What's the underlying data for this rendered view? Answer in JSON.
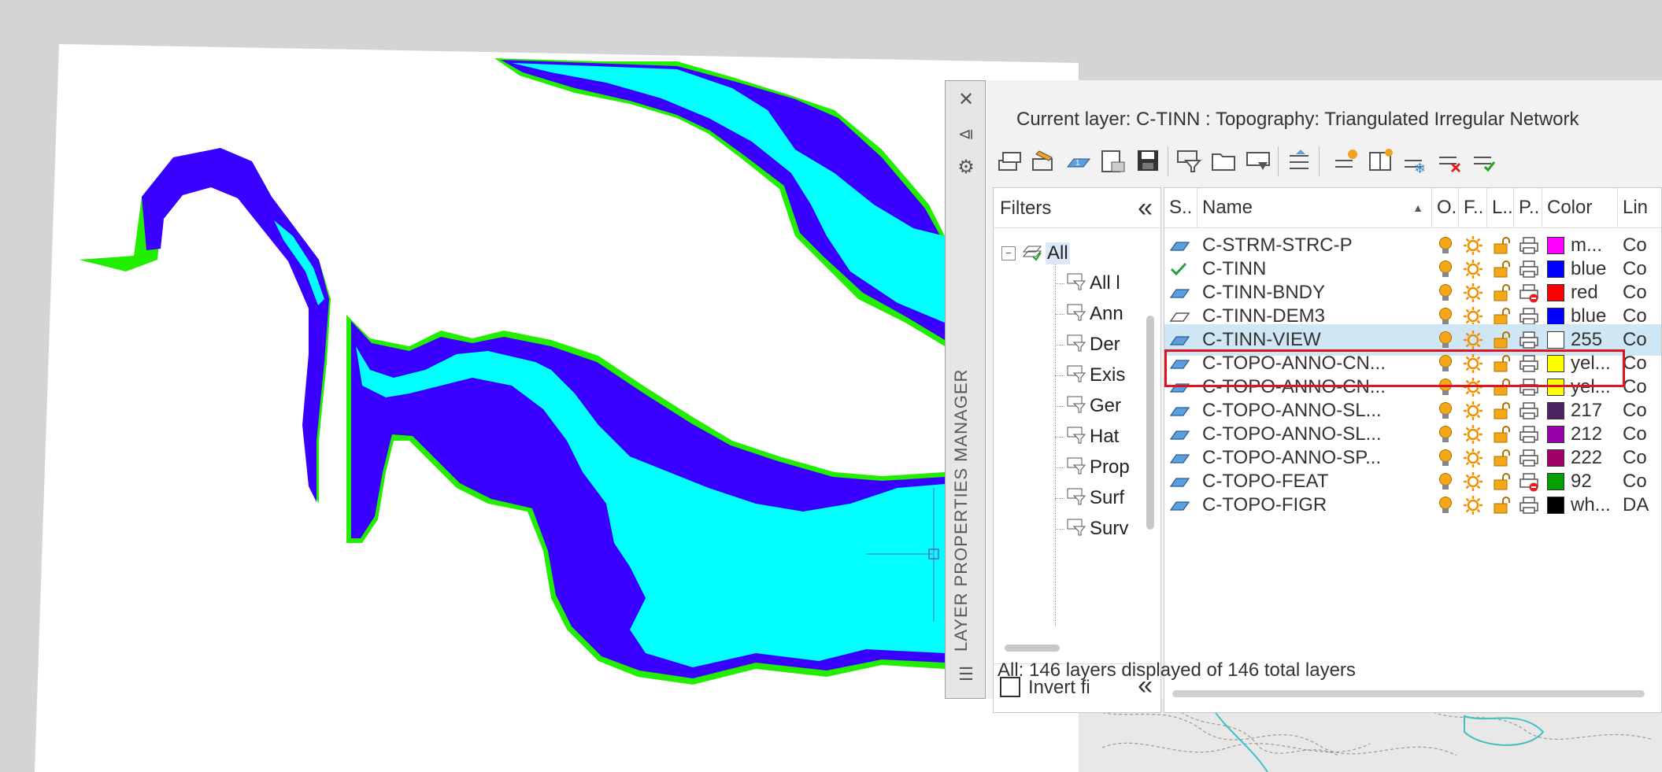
{
  "colors": {
    "canvas_bg": "#d4d4d4",
    "paper": "#ffffff",
    "water_cyan": "#00ffff",
    "water_blue": "#3a00ff",
    "bank_green": "#22ee00",
    "highlight_red": "#e0141e",
    "selected_row": "#cfe6f5"
  },
  "palette": {
    "vertical_title": "LAYER PROPERTIES MANAGER",
    "strip_icons": [
      "close-icon",
      "auto-hide-icon",
      "gear-icon"
    ],
    "current_layer": "Current layer: C-TINN : Topography: Triangulated Irregular Network",
    "toolbar_icons": [
      "new-property-filter-icon",
      "new-group-filter-icon",
      "layer-states-icon",
      "new-layer-icon",
      "save-icon",
      "layer-filter-icon",
      "folder-icon",
      "layer-manager-icon",
      "layer-isolate-icon",
      "new-vp-frozen-icon",
      "layer-states-book-icon",
      "freeze-all-icon",
      "delete-layer-icon",
      "set-current-icon"
    ],
    "filters": {
      "title": "Filters",
      "collapse": "«",
      "tree": [
        {
          "label": "All",
          "root": true
        },
        {
          "label": "All l"
        },
        {
          "label": "Ann"
        },
        {
          "label": "Der"
        },
        {
          "label": "Exis"
        },
        {
          "label": "Ger"
        },
        {
          "label": "Hat"
        },
        {
          "label": "Prop"
        },
        {
          "label": "Surf"
        },
        {
          "label": "Surv"
        }
      ],
      "invert_label": "Invert fi",
      "invert_checked": false,
      "invert_collapse": "«"
    },
    "columns": [
      "S..",
      "Name",
      "O..",
      "F..",
      "L..",
      "P..",
      "Color",
      "Lin"
    ],
    "rows": [
      {
        "status": "layer",
        "name": "C-STRM-STRC-P",
        "plot": "print",
        "swatch": "#ff00ff",
        "color": "m...",
        "lt": "Co"
      },
      {
        "status": "current",
        "name": "C-TINN",
        "plot": "print",
        "swatch": "#0000ff",
        "color": "blue",
        "lt": "Co"
      },
      {
        "status": "layer",
        "name": "C-TINN-BNDY",
        "plot": "no-print",
        "swatch": "#ff0000",
        "color": "red",
        "lt": "Co"
      },
      {
        "status": "empty",
        "name": "C-TINN-DEM3",
        "plot": "print",
        "swatch": "#0000ff",
        "color": "blue",
        "lt": "Co"
      },
      {
        "status": "layer",
        "name": "C-TINN-VIEW",
        "plot": "print",
        "swatch": "#ffffff",
        "color": "255",
        "lt": "Co",
        "selected": true
      },
      {
        "status": "layer",
        "name": "C-TOPO-ANNO-CN...",
        "plot": "print",
        "swatch": "#ffff00",
        "color": "yel...",
        "lt": "Co"
      },
      {
        "status": "layer",
        "name": "C-TOPO-ANNO-CN...",
        "plot": "print",
        "swatch": "#ffff00",
        "color": "yel...",
        "lt": "Co"
      },
      {
        "status": "layer",
        "name": "C-TOPO-ANNO-SL...",
        "plot": "print",
        "swatch": "#4a2360",
        "color": "217",
        "lt": "Co"
      },
      {
        "status": "layer",
        "name": "C-TOPO-ANNO-SL...",
        "plot": "print",
        "swatch": "#9a00a8",
        "color": "212",
        "lt": "Co"
      },
      {
        "status": "layer",
        "name": "C-TOPO-ANNO-SP...",
        "plot": "print",
        "swatch": "#a0006a",
        "color": "222",
        "lt": "Co"
      },
      {
        "status": "layer",
        "name": "C-TOPO-FEAT",
        "plot": "no-print",
        "swatch": "#00a000",
        "color": "92",
        "lt": "Co"
      },
      {
        "status": "layer",
        "name": "C-TOPO-FIGR",
        "plot": "print",
        "swatch": "#000000",
        "color": "wh...",
        "lt": "DA"
      }
    ],
    "status_text": "All: 146 layers displayed of 146 total layers"
  }
}
